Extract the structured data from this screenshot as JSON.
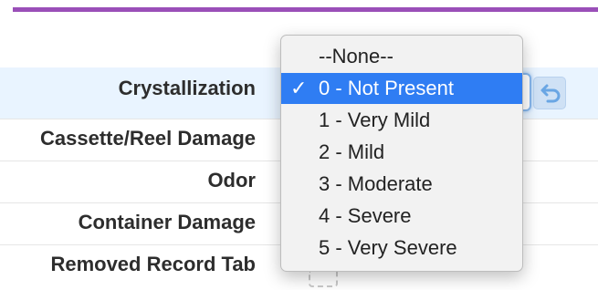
{
  "form": {
    "fields": [
      {
        "label": "Crystallization"
      },
      {
        "label": "Cassette/Reel Damage"
      },
      {
        "label": "Odor"
      },
      {
        "label": "Container Damage"
      },
      {
        "label": "Removed Record Tab"
      }
    ]
  },
  "dropdown": {
    "options": [
      {
        "label": "--None--",
        "selected": false
      },
      {
        "label": "0 - Not Present",
        "selected": true
      },
      {
        "label": "1 - Very Mild",
        "selected": false
      },
      {
        "label": "2 - Mild",
        "selected": false
      },
      {
        "label": "3 - Moderate",
        "selected": false
      },
      {
        "label": "4 - Severe",
        "selected": false
      },
      {
        "label": "5 - Very Severe",
        "selected": false
      }
    ],
    "check_mark": "✓"
  },
  "icons": {
    "undo": "undo-icon"
  },
  "colors": {
    "accent_bar": "#9a4fb8",
    "selected_option": "#2f7df3",
    "row_highlight": "#e9f4ff"
  }
}
